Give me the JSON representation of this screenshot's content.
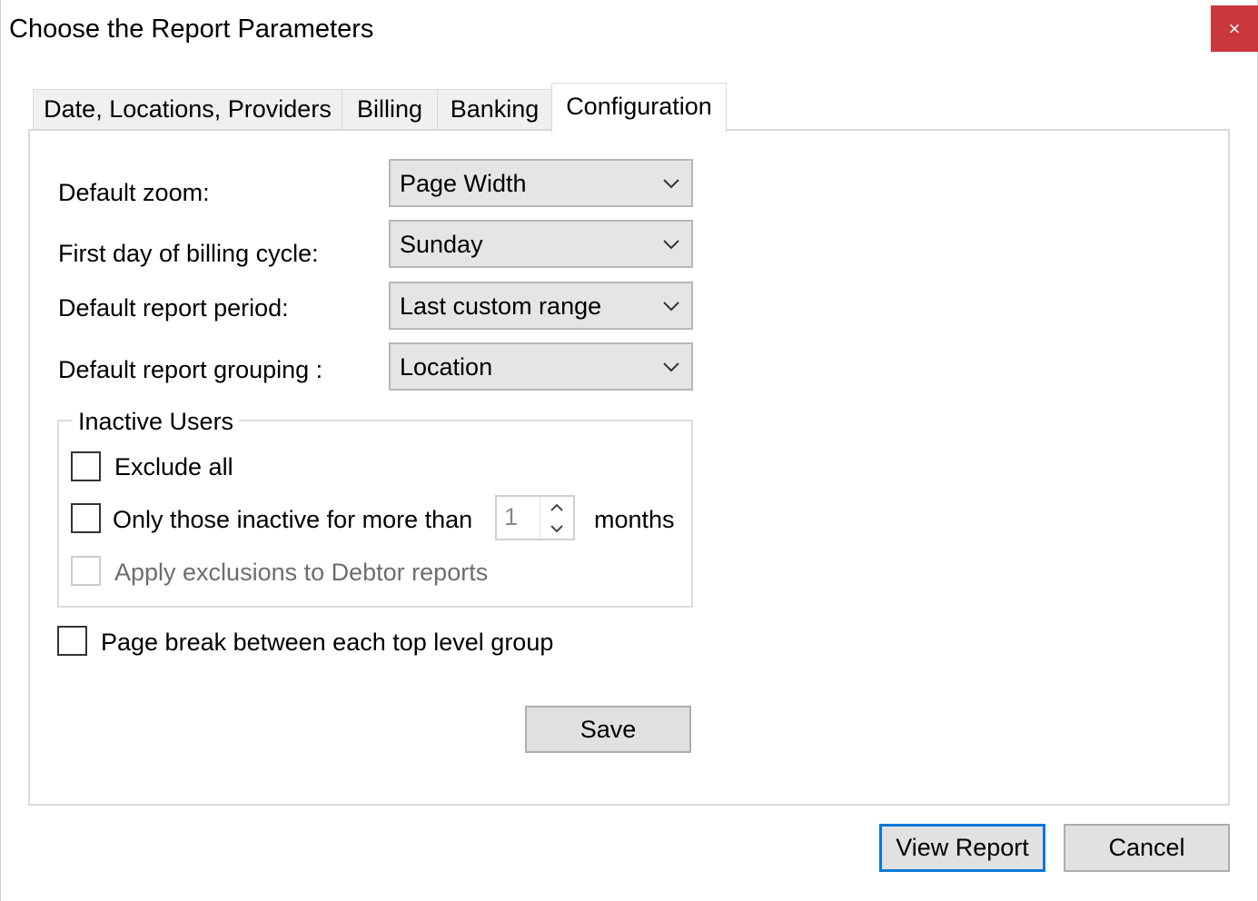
{
  "window": {
    "title": "Choose the Report Parameters",
    "close_glyph": "×"
  },
  "tabs": [
    {
      "label": "Date, Locations, Providers"
    },
    {
      "label": "Billing"
    },
    {
      "label": "Banking"
    },
    {
      "label": "Configuration",
      "active": true
    }
  ],
  "config": {
    "default_zoom": {
      "label": "Default zoom:",
      "value": "Page Width"
    },
    "first_day": {
      "label": "First day of billing cycle:",
      "value": "Sunday"
    },
    "report_period": {
      "label": "Default report period:",
      "value": "Last custom range"
    },
    "report_grouping": {
      "label": "Default report grouping :",
      "value": "Location"
    }
  },
  "inactive_users": {
    "legend": "Inactive Users",
    "exclude_all": {
      "label": "Exclude all",
      "checked": false
    },
    "only_inactive": {
      "label": "Only those inactive for more than",
      "checked": false,
      "months_value": "1",
      "months_suffix": "months"
    },
    "apply_exclusions": {
      "label": "Apply exclusions to Debtor reports",
      "checked": false,
      "disabled": true
    }
  },
  "page_break": {
    "label": "Page break between each top level group",
    "checked": false
  },
  "buttons": {
    "save": "Save",
    "view_report": "View Report",
    "cancel": "Cancel"
  },
  "icons": {
    "close": "close-icon",
    "dropdown": "chevron-down-icon",
    "spin_up": "arrow-up-icon",
    "spin_down": "arrow-down-icon"
  },
  "colors": {
    "close_bg": "#c9363b",
    "accent": "#0a78d7"
  }
}
